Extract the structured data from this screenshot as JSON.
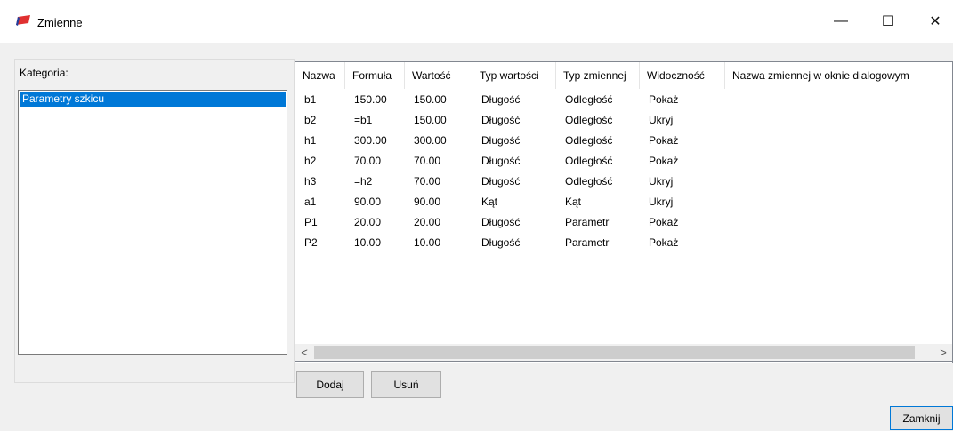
{
  "window": {
    "title": "Zmienne",
    "accent_color": "#0078d7",
    "icon_colors": [
      "#e03030",
      "#2040a0"
    ]
  },
  "titlebar_controls": {
    "minimize": "—",
    "maximize": "☐",
    "close": "✕"
  },
  "category": {
    "label": "Kategoria:",
    "items": [
      "Parametry szkicu"
    ],
    "selected": "Parametry szkicu"
  },
  "table": {
    "columns": [
      "Nazwa",
      "Formuła",
      "Wartość",
      "Typ wartości",
      "Typ zmiennej",
      "Widoczność",
      "Nazwa zmiennej w oknie dialogowym"
    ],
    "rows": [
      [
        "b1",
        "150.00",
        "150.00",
        "Długość",
        "Odległość",
        "Pokaż",
        ""
      ],
      [
        "b2",
        "=b1",
        "150.00",
        "Długość",
        "Odległość",
        "Ukryj",
        ""
      ],
      [
        "h1",
        "300.00",
        "300.00",
        "Długość",
        "Odległość",
        "Pokaż",
        ""
      ],
      [
        "h2",
        "70.00",
        "70.00",
        "Długość",
        "Odległość",
        "Pokaż",
        ""
      ],
      [
        "h3",
        "=h2",
        "70.00",
        "Długość",
        "Odległość",
        "Ukryj",
        ""
      ],
      [
        "a1",
        "90.00",
        "90.00",
        "Kąt",
        "Kąt",
        "Ukryj",
        ""
      ],
      [
        "P1",
        "20.00",
        "20.00",
        "Długość",
        "Parametr",
        "Pokaż",
        ""
      ],
      [
        "P2",
        "10.00",
        "10.00",
        "Długość",
        "Parametr",
        "Pokaż",
        ""
      ]
    ]
  },
  "scrollbar": {
    "left_arrow": "<",
    "right_arrow": ">"
  },
  "buttons": {
    "add": "Dodaj",
    "remove": "Usuń",
    "close": "Zamknij"
  }
}
